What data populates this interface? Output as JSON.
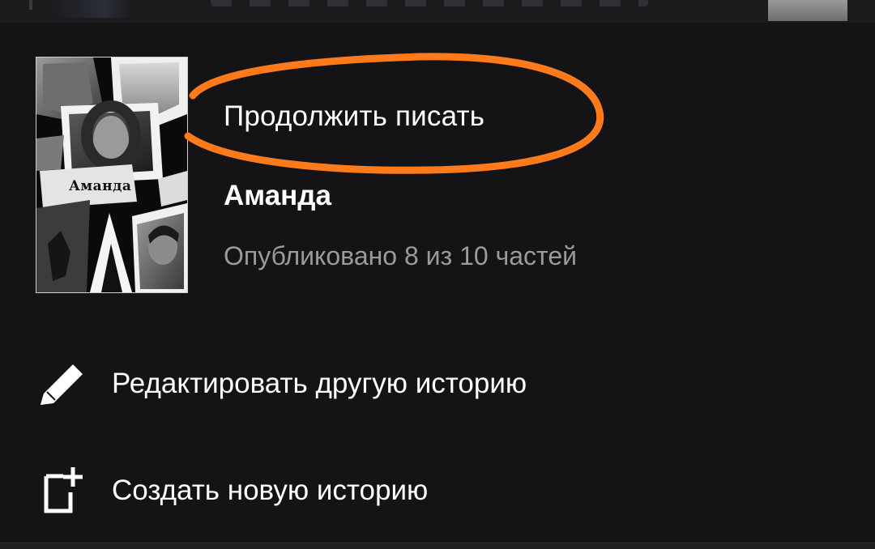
{
  "story": {
    "cover_title": "Аманда",
    "continue_label": "Продолжить писать",
    "title": "Аманда",
    "progress": "Опубликовано 8 из 10 частей"
  },
  "actions": {
    "edit_other": {
      "label": "Редактировать другую историю",
      "icon": "pencil-icon"
    },
    "create_new": {
      "label": "Создать новую историю",
      "icon": "add-document-icon"
    }
  },
  "colors": {
    "background": "#141315",
    "text_primary": "#ffffff",
    "text_secondary": "#9b9a9e",
    "annotation": "#ff7a1a"
  }
}
